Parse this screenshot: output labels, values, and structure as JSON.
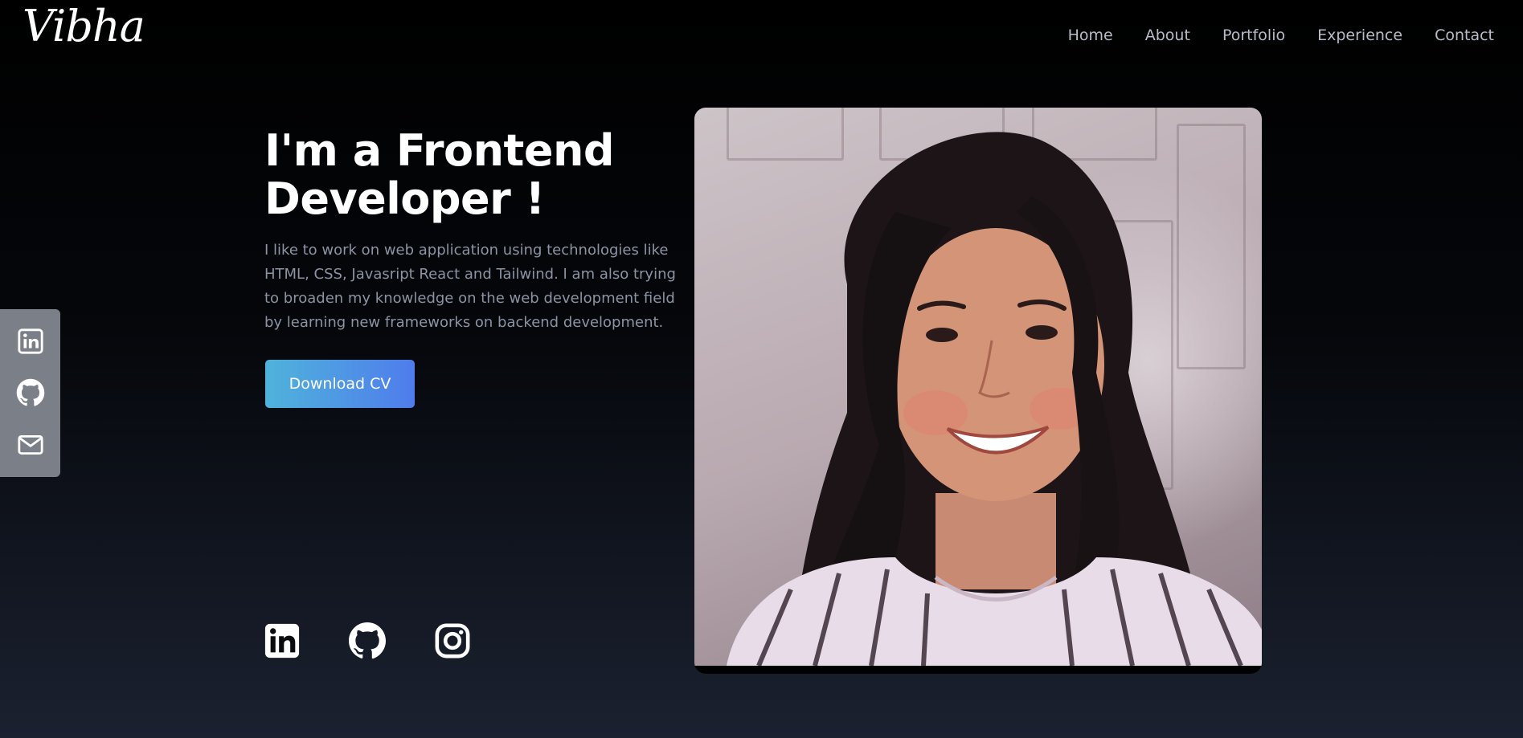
{
  "header": {
    "logo": "Vibha",
    "nav": [
      "Home",
      "About",
      "Portfolio",
      "Experience",
      "Contact"
    ]
  },
  "hero": {
    "title_line1": "I'm a Frontend",
    "title_line2": "Developer !",
    "description": "I like to work on web application using technologies like HTML, CSS, Javasript React and Tailwind. I am also trying to broaden my knowledge on the web development field by learning new frameworks on backend development.",
    "cv_button": "Download CV"
  },
  "sidebar": {
    "icons": [
      "linkedin-icon",
      "github-icon",
      "mail-icon"
    ]
  },
  "bottom_icons": [
    "linkedin-icon",
    "github-icon",
    "instagram-icon"
  ],
  "colors": {
    "background_top": "#000000",
    "background_bottom": "#1b2130",
    "nav_text": "#b7bcc8",
    "description_text": "#8c93a3",
    "button_gradient_start": "#4fb3db",
    "button_gradient_end": "#4f7cec",
    "sidebar_bg": "#7b7f88"
  }
}
